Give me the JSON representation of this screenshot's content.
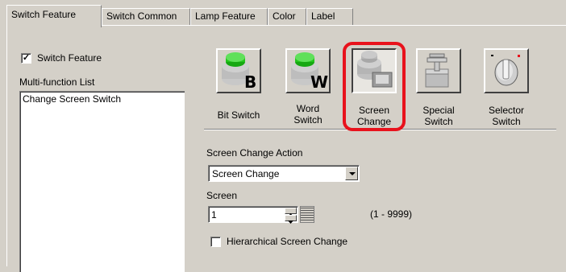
{
  "tabs": [
    {
      "label": "Switch Feature",
      "active": true
    },
    {
      "label": "Switch Common",
      "active": false
    },
    {
      "label": "Lamp Feature",
      "active": false
    },
    {
      "label": "Color",
      "active": false
    },
    {
      "label": "Label",
      "active": false
    }
  ],
  "left": {
    "switch_feature_checkbox": {
      "label": "Switch Feature",
      "checked": true,
      "mark": "✓"
    },
    "multi_function_label": "Multi-function List",
    "list_items": [
      "Change Screen Switch"
    ]
  },
  "tools": [
    {
      "label_line1": "Bit Switch",
      "label_line2": "",
      "icon": "bit-switch-icon",
      "letter": "B"
    },
    {
      "label_line1": "Word",
      "label_line2": "Switch",
      "icon": "word-switch-icon",
      "letter": "W"
    },
    {
      "label_line1": "Screen",
      "label_line2": "Change",
      "icon": "screen-change-icon",
      "selected": true
    },
    {
      "label_line1": "Special",
      "label_line2": "Switch",
      "icon": "special-switch-icon"
    },
    {
      "label_line1": "Selector",
      "label_line2": "Switch",
      "icon": "selector-switch-icon"
    }
  ],
  "action": {
    "label": "Screen Change Action",
    "value": "Screen Change"
  },
  "screen": {
    "label": "Screen",
    "value": "1",
    "range": "(1 - 9999)"
  },
  "hierarchical": {
    "label": "Hierarchical Screen Change",
    "checked": false
  },
  "colors": {
    "highlight": "#e8121c",
    "green": "#22c51c"
  }
}
